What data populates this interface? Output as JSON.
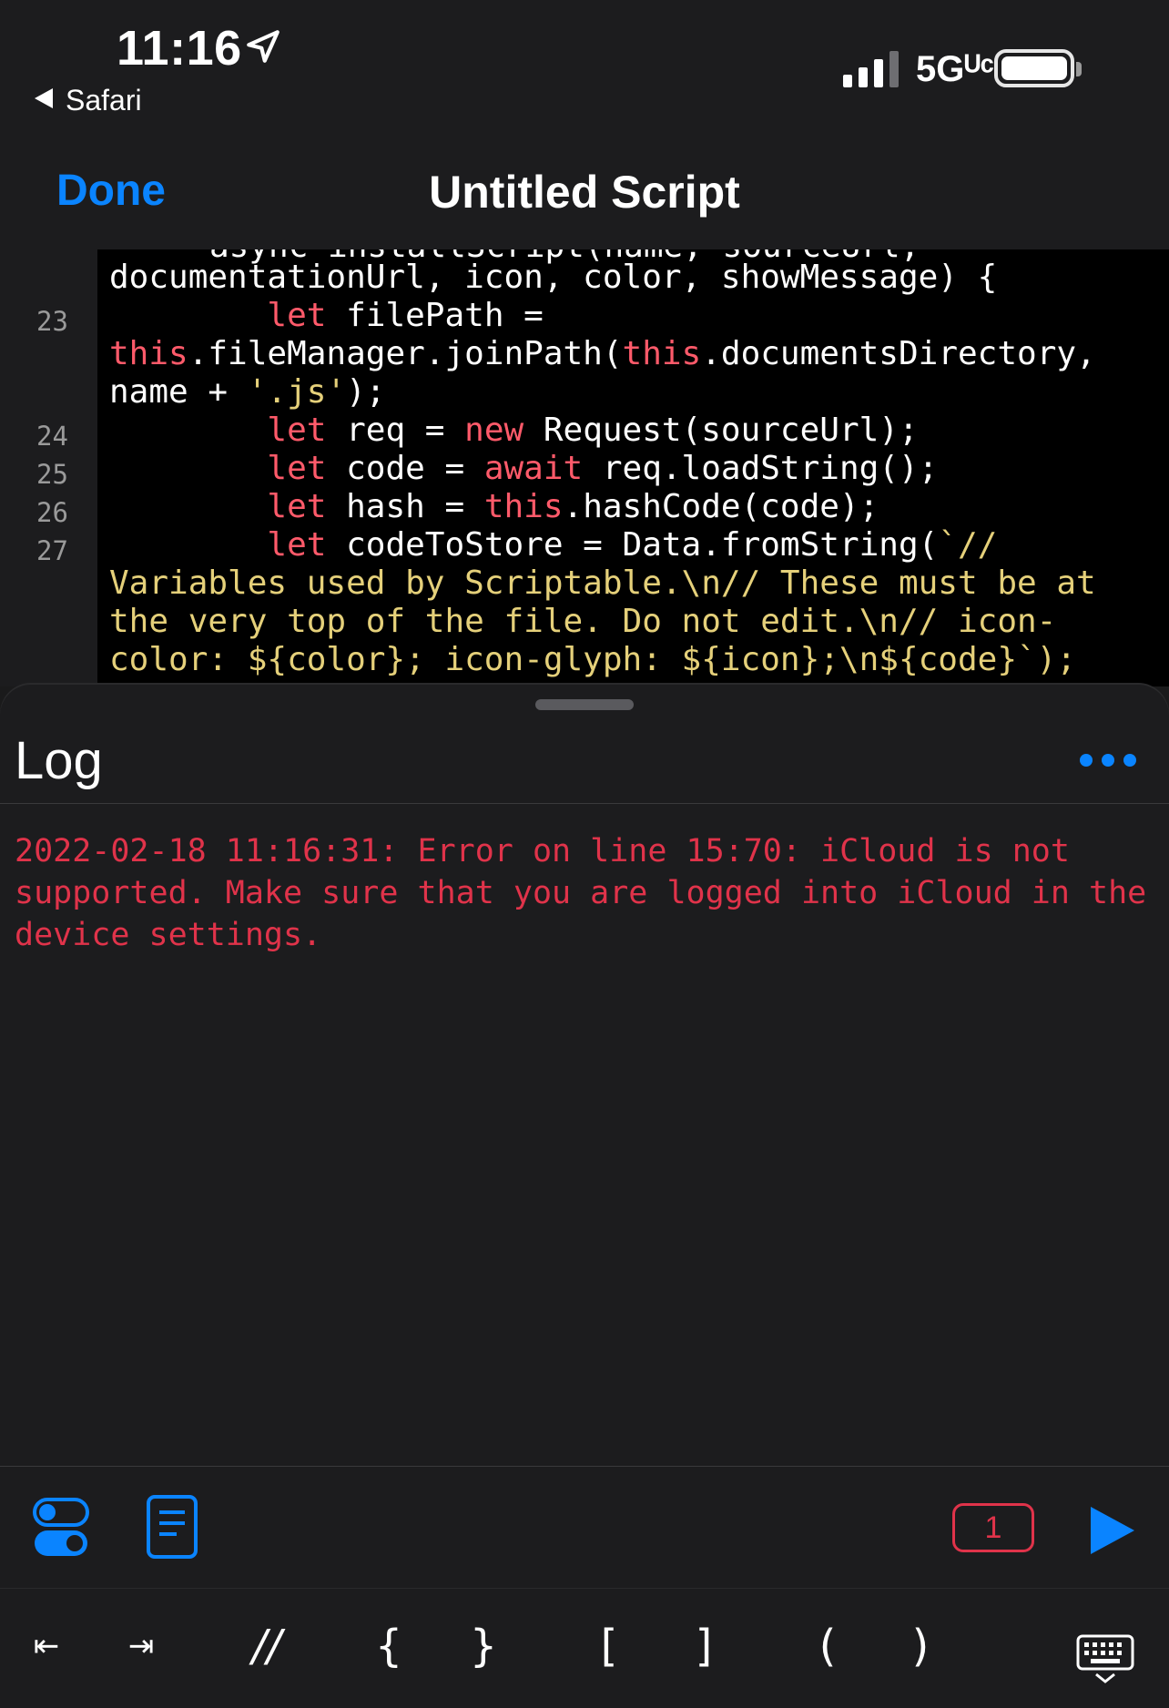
{
  "status_bar": {
    "time": "11:16",
    "back_app": "Safari",
    "network": "5Gᵁᶜ"
  },
  "nav": {
    "done_label": "Done",
    "title": "Untitled Script"
  },
  "editor": {
    "partial_top_line": "async installScript(name, sourceUrl,",
    "lines": [
      {
        "number": "",
        "text": "documentationUrl, icon, color, showMessage) {"
      },
      {
        "number": "23",
        "text": "        let filePath ="
      },
      {
        "number": "",
        "text": "this.fileManager.joinPath(this.documentsDirectory,"
      },
      {
        "number": "",
        "text": "name + '.js');"
      },
      {
        "number": "24",
        "text": "        let req = new Request(sourceUrl);"
      },
      {
        "number": "25",
        "text": "        let code = await req.loadString();"
      },
      {
        "number": "26",
        "text": "        let hash = this.hashCode(code);"
      },
      {
        "number": "27",
        "text": "        let codeToStore = Data.fromString(`//"
      },
      {
        "number": "",
        "text": "Variables used by Scriptable.\\n// These must be at"
      },
      {
        "number": "",
        "text": "the very top of the file. Do not edit.\\n// icon-"
      },
      {
        "number": "",
        "text": "color: ${color}; icon-glyph: ${icon};\\n${code}`);"
      }
    ]
  },
  "log": {
    "title": "Log",
    "entry": "2022-02-18 11:16:31: Error on line 15:70: iCloud is not supported. Make sure that you are logged into iCloud in the device settings."
  },
  "toolbar": {
    "error_count": "1"
  },
  "accessory": {
    "keys": [
      "⇤",
      "⇥",
      "//",
      "{",
      "}",
      "[",
      "]",
      "(",
      ")"
    ]
  },
  "colors": {
    "accent": "#0a84ff",
    "error": "#e0334a",
    "keyword": "#ff5a6a",
    "string": "#e5d07a"
  }
}
